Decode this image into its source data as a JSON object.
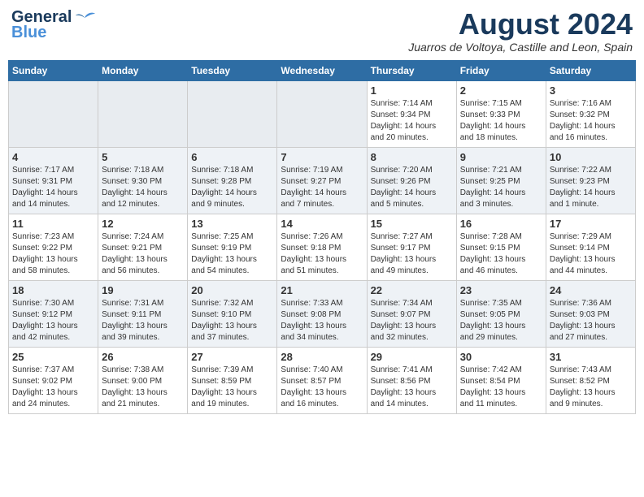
{
  "header": {
    "logo_line1": "General",
    "logo_line2": "Blue",
    "month_title": "August 2024",
    "subtitle": "Juarros de Voltoya, Castille and Leon, Spain"
  },
  "days_of_week": [
    "Sunday",
    "Monday",
    "Tuesday",
    "Wednesday",
    "Thursday",
    "Friday",
    "Saturday"
  ],
  "weeks": [
    [
      {
        "day": "",
        "info": ""
      },
      {
        "day": "",
        "info": ""
      },
      {
        "day": "",
        "info": ""
      },
      {
        "day": "",
        "info": ""
      },
      {
        "day": "1",
        "info": "Sunrise: 7:14 AM\nSunset: 9:34 PM\nDaylight: 14 hours\nand 20 minutes."
      },
      {
        "day": "2",
        "info": "Sunrise: 7:15 AM\nSunset: 9:33 PM\nDaylight: 14 hours\nand 18 minutes."
      },
      {
        "day": "3",
        "info": "Sunrise: 7:16 AM\nSunset: 9:32 PM\nDaylight: 14 hours\nand 16 minutes."
      }
    ],
    [
      {
        "day": "4",
        "info": "Sunrise: 7:17 AM\nSunset: 9:31 PM\nDaylight: 14 hours\nand 14 minutes."
      },
      {
        "day": "5",
        "info": "Sunrise: 7:18 AM\nSunset: 9:30 PM\nDaylight: 14 hours\nand 12 minutes."
      },
      {
        "day": "6",
        "info": "Sunrise: 7:18 AM\nSunset: 9:28 PM\nDaylight: 14 hours\nand 9 minutes."
      },
      {
        "day": "7",
        "info": "Sunrise: 7:19 AM\nSunset: 9:27 PM\nDaylight: 14 hours\nand 7 minutes."
      },
      {
        "day": "8",
        "info": "Sunrise: 7:20 AM\nSunset: 9:26 PM\nDaylight: 14 hours\nand 5 minutes."
      },
      {
        "day": "9",
        "info": "Sunrise: 7:21 AM\nSunset: 9:25 PM\nDaylight: 14 hours\nand 3 minutes."
      },
      {
        "day": "10",
        "info": "Sunrise: 7:22 AM\nSunset: 9:23 PM\nDaylight: 14 hours\nand 1 minute."
      }
    ],
    [
      {
        "day": "11",
        "info": "Sunrise: 7:23 AM\nSunset: 9:22 PM\nDaylight: 13 hours\nand 58 minutes."
      },
      {
        "day": "12",
        "info": "Sunrise: 7:24 AM\nSunset: 9:21 PM\nDaylight: 13 hours\nand 56 minutes."
      },
      {
        "day": "13",
        "info": "Sunrise: 7:25 AM\nSunset: 9:19 PM\nDaylight: 13 hours\nand 54 minutes."
      },
      {
        "day": "14",
        "info": "Sunrise: 7:26 AM\nSunset: 9:18 PM\nDaylight: 13 hours\nand 51 minutes."
      },
      {
        "day": "15",
        "info": "Sunrise: 7:27 AM\nSunset: 9:17 PM\nDaylight: 13 hours\nand 49 minutes."
      },
      {
        "day": "16",
        "info": "Sunrise: 7:28 AM\nSunset: 9:15 PM\nDaylight: 13 hours\nand 46 minutes."
      },
      {
        "day": "17",
        "info": "Sunrise: 7:29 AM\nSunset: 9:14 PM\nDaylight: 13 hours\nand 44 minutes."
      }
    ],
    [
      {
        "day": "18",
        "info": "Sunrise: 7:30 AM\nSunset: 9:12 PM\nDaylight: 13 hours\nand 42 minutes."
      },
      {
        "day": "19",
        "info": "Sunrise: 7:31 AM\nSunset: 9:11 PM\nDaylight: 13 hours\nand 39 minutes."
      },
      {
        "day": "20",
        "info": "Sunrise: 7:32 AM\nSunset: 9:10 PM\nDaylight: 13 hours\nand 37 minutes."
      },
      {
        "day": "21",
        "info": "Sunrise: 7:33 AM\nSunset: 9:08 PM\nDaylight: 13 hours\nand 34 minutes."
      },
      {
        "day": "22",
        "info": "Sunrise: 7:34 AM\nSunset: 9:07 PM\nDaylight: 13 hours\nand 32 minutes."
      },
      {
        "day": "23",
        "info": "Sunrise: 7:35 AM\nSunset: 9:05 PM\nDaylight: 13 hours\nand 29 minutes."
      },
      {
        "day": "24",
        "info": "Sunrise: 7:36 AM\nSunset: 9:03 PM\nDaylight: 13 hours\nand 27 minutes."
      }
    ],
    [
      {
        "day": "25",
        "info": "Sunrise: 7:37 AM\nSunset: 9:02 PM\nDaylight: 13 hours\nand 24 minutes."
      },
      {
        "day": "26",
        "info": "Sunrise: 7:38 AM\nSunset: 9:00 PM\nDaylight: 13 hours\nand 21 minutes."
      },
      {
        "day": "27",
        "info": "Sunrise: 7:39 AM\nSunset: 8:59 PM\nDaylight: 13 hours\nand 19 minutes."
      },
      {
        "day": "28",
        "info": "Sunrise: 7:40 AM\nSunset: 8:57 PM\nDaylight: 13 hours\nand 16 minutes."
      },
      {
        "day": "29",
        "info": "Sunrise: 7:41 AM\nSunset: 8:56 PM\nDaylight: 13 hours\nand 14 minutes."
      },
      {
        "day": "30",
        "info": "Sunrise: 7:42 AM\nSunset: 8:54 PM\nDaylight: 13 hours\nand 11 minutes."
      },
      {
        "day": "31",
        "info": "Sunrise: 7:43 AM\nSunset: 8:52 PM\nDaylight: 13 hours\nand 9 minutes."
      }
    ]
  ]
}
